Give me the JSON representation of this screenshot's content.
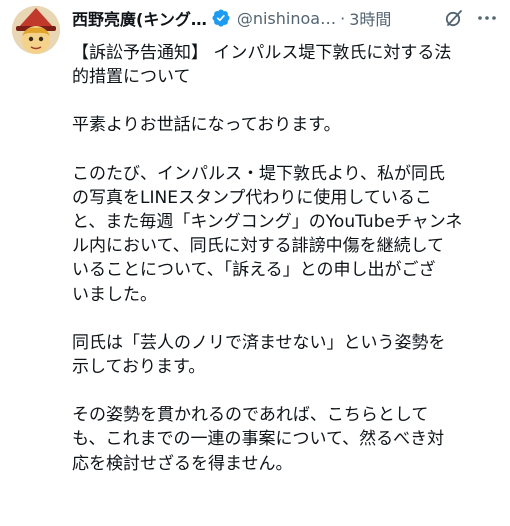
{
  "author": {
    "display_name": "西野亮廣(キング…",
    "handle": "@nishinoa…",
    "separator": "·",
    "time": "3時間"
  },
  "icons": {
    "avatar": "avatar-cartoon-witch",
    "verified": "verified-badge-icon",
    "grok": "grok-icon",
    "more": "more-icon"
  },
  "colors": {
    "verified": "#1d9bf0",
    "secondary_text": "#536471",
    "text": "#0f1419"
  },
  "tweet": {
    "paragraphs": [
      "【訴訟予告通知】 インパルス堤下敦氏に対する法\n的措置について",
      "平素よりお世話になっております。",
      "このたび、インパルス・堤下敦氏より、私が同氏\nの写真をLINEスタンプ代わりに使用しているこ\nと、また毎週「キングコング」のYouTubeチャンネ\nル内において、同氏に対する誹謗中傷を継続して\nいることについて、「訴える」との申し出がござ\nいました。",
      "同氏は「芸人のノリで済ませない」という姿勢を\n示しております。",
      "その姿勢を貫かれるのであれば、こちらとして\nも、これまでの一連の事案について、然るべき対\n応を検討せざるを得ません。"
    ]
  }
}
